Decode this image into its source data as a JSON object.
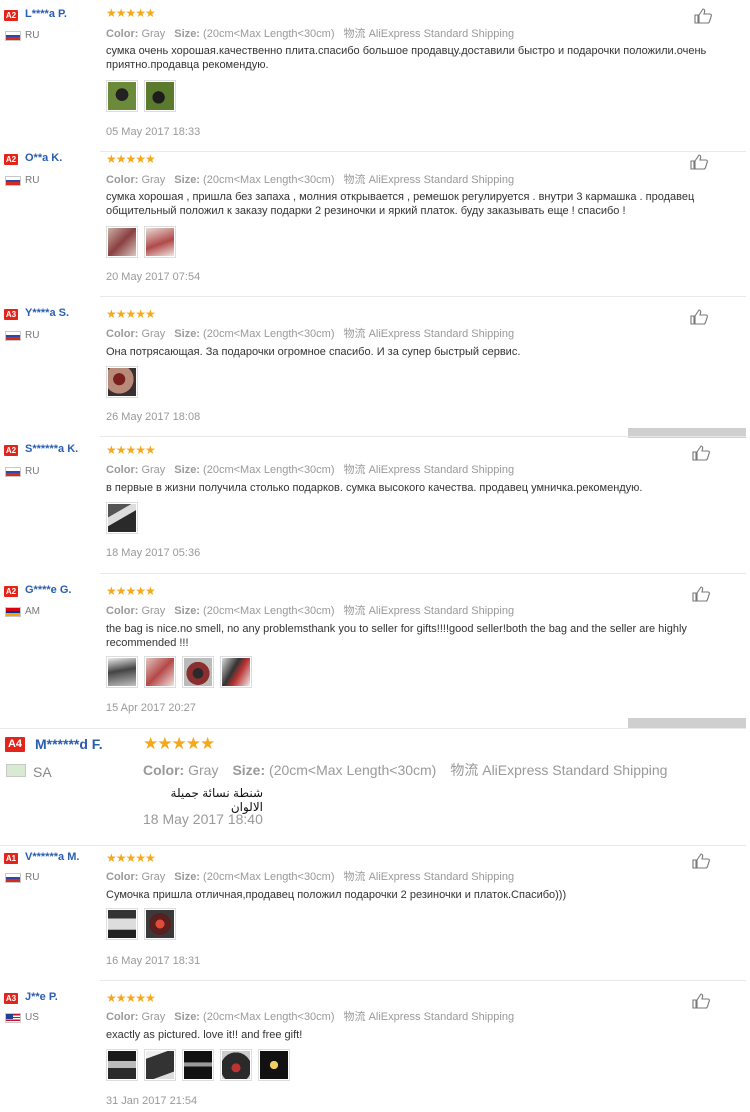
{
  "labels": {
    "color": "Color:",
    "size": "Size:",
    "ship_icon": "物流"
  },
  "colors": {
    "star": "#f6a81c",
    "level_badge": "#e3241b",
    "name": "#2a5db0"
  },
  "reviews": [
    {
      "level": "A2",
      "name": "L****a P.",
      "country": "RU",
      "flag": "ru",
      "rating": 5,
      "color": "Gray",
      "size": "(20cm<Max Length<30cm)",
      "shipping": "AliExpress Standard Shipping",
      "text": "сумка очень хорошая.качественно плита.спасибо большое продавцу.доставили быстро и подарочки положили.очень приятно.продавца рекомендую.",
      "date": "05 May 2017 18:33"
    },
    {
      "level": "A2",
      "name": "O**a K.",
      "country": "RU",
      "flag": "ru",
      "rating": 5,
      "color": "Gray",
      "size": "(20cm<Max Length<30cm)",
      "shipping": "AliExpress Standard Shipping",
      "text": "сумка хорошая , пришла без запаха , молния открывается , ремешок регулируется . внутри 3 кармашка . продавец общительный положил к заказу подарки 2 резиночки и яркий платок. буду заказывать еще ! спасибо !",
      "date": "20 May 2017 07:54"
    },
    {
      "level": "A3",
      "name": "Y****a S.",
      "country": "RU",
      "flag": "ru",
      "rating": 5,
      "color": "Gray",
      "size": "(20cm<Max Length<30cm)",
      "shipping": "AliExpress Standard Shipping",
      "text": "Она потрясающая. За подарочки огромное спасибо. И за супер быстрый сервис.",
      "date": "26 May 2017 18:08"
    },
    {
      "level": "A2",
      "name": "S******a K.",
      "country": "RU",
      "flag": "ru",
      "rating": 5,
      "color": "Gray",
      "size": "(20cm<Max Length<30cm)",
      "shipping": "AliExpress Standard Shipping",
      "text": "в первые в жизни получила столько подарков. сумка высокого качества. продавец умничка.рекомендую.",
      "date": "18 May 2017 05:36"
    },
    {
      "level": "A2",
      "name": "G****e G.",
      "country": "AM",
      "flag": "am",
      "rating": 5,
      "color": "Gray",
      "size": "(20cm<Max Length<30cm)",
      "shipping": "AliExpress Standard Shipping",
      "text": "the bag is nice.no smell, no any problemsthank you to seller for gifts!!!!good seller!both the bag and the seller are highly recommended !!!",
      "date": "15 Apr 2017 20:27"
    },
    {
      "level": "A4",
      "name": "M******d F.",
      "country": "SA",
      "flag": "sa",
      "rating": 5,
      "color": "Gray",
      "size": "(20cm<Max Length<30cm)",
      "shipping": "AliExpress Standard Shipping",
      "text": "شنطة نسائة جميلة الالوان",
      "date": "18 May 2017 18:40"
    },
    {
      "level": "A1",
      "name": "V******a M.",
      "country": "RU",
      "flag": "ru",
      "rating": 5,
      "color": "Gray",
      "size": "(20cm<Max Length<30cm)",
      "shipping": "AliExpress Standard Shipping",
      "text": "Сумочка пришла отличная,продавец положил подарочки 2 резиночки и платок.Спасибо)))",
      "date": "16 May 2017 18:31"
    },
    {
      "level": "A3",
      "name": "J**e P.",
      "country": "US",
      "flag": "us",
      "rating": 5,
      "color": "Gray",
      "size": "(20cm<Max Length<30cm)",
      "shipping": "AliExpress Standard Shipping",
      "text": "exactly as pictured. love it!! and free gift!",
      "date": "31 Jan 2017 21:54"
    }
  ]
}
